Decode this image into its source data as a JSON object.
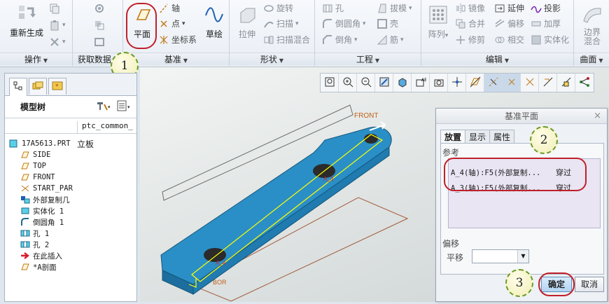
{
  "ribbon": {
    "groups": [
      {
        "title": "操作"
      },
      {
        "title": "获取数据"
      },
      {
        "title": "基准"
      },
      {
        "title": "形状"
      },
      {
        "title": "工程"
      },
      {
        "title": "编辑"
      },
      {
        "title": "曲面"
      }
    ],
    "ops": {
      "regen": "重新生成"
    },
    "datum": {
      "plane": "平面",
      "axis": "轴",
      "point": "点",
      "csys": "坐标系",
      "sketch": "草绘"
    },
    "shape": {
      "extrude": "拉伸",
      "revolve": "旋转",
      "sweep": "扫描",
      "swept_blend": "扫描混合"
    },
    "engineering": {
      "hole": "孔",
      "round": "倒圆角",
      "chamfer": "倒角",
      "draft": "拔模",
      "shell": "壳",
      "rib": "筋"
    },
    "editing": {
      "pattern": "阵列",
      "mirror": "镜像",
      "merge": "合并",
      "trim": "修剪",
      "extend": "延伸",
      "offset": "偏移",
      "intersect": "相交",
      "project": "投影",
      "thicken": "加厚",
      "solidify": "实体化"
    },
    "surface": {
      "boundary": "边界",
      "blend": "混合"
    }
  },
  "callouts": [
    "1",
    "2",
    "3"
  ],
  "model_tree": {
    "title": "模型树",
    "column": "ptc_common_",
    "root": {
      "name": "17A5613.PRT",
      "value": "立板"
    },
    "items": [
      {
        "icon": "plane-icon",
        "label": "SIDE"
      },
      {
        "icon": "plane-icon",
        "label": "TOP"
      },
      {
        "icon": "plane-icon",
        "label": "FRONT"
      },
      {
        "icon": "csys-icon",
        "label": "START_PAR"
      },
      {
        "icon": "copy-geom-icon",
        "label": "外部复制几"
      },
      {
        "icon": "solidify-icon",
        "label": "实体化 1"
      },
      {
        "icon": "round-icon",
        "label": "倒圆角 1"
      },
      {
        "icon": "hole-icon",
        "label": "孔 1"
      },
      {
        "icon": "hole-icon",
        "label": "孔 2"
      },
      {
        "icon": "insert-arrow-icon",
        "label": "在此插入"
      },
      {
        "icon": "plane-icon",
        "label": "*A剖面"
      }
    ]
  },
  "viewport": {
    "labels": {
      "front": "FRONT",
      "axis_a3": "A_3",
      "axis_a4": "A_4",
      "bottom": "BOR"
    }
  },
  "dialog": {
    "title": "基准平面",
    "tabs": [
      "放置",
      "显示",
      "属性"
    ],
    "ref_label": "参考",
    "references": [
      {
        "ref": "A_4(轴):F5(外部复制...",
        "type": "穿过"
      },
      {
        "ref": "A_3(轴):F5(外部复制...",
        "type": "穿过"
      }
    ],
    "offset_label": "偏移",
    "translate_label": "平移",
    "translate_value": "",
    "ok": "确定",
    "cancel": "取消"
  },
  "colors": {
    "part": "#2a8fc6",
    "highlight": "#ffff00",
    "callout_ring": "#c0202a"
  }
}
